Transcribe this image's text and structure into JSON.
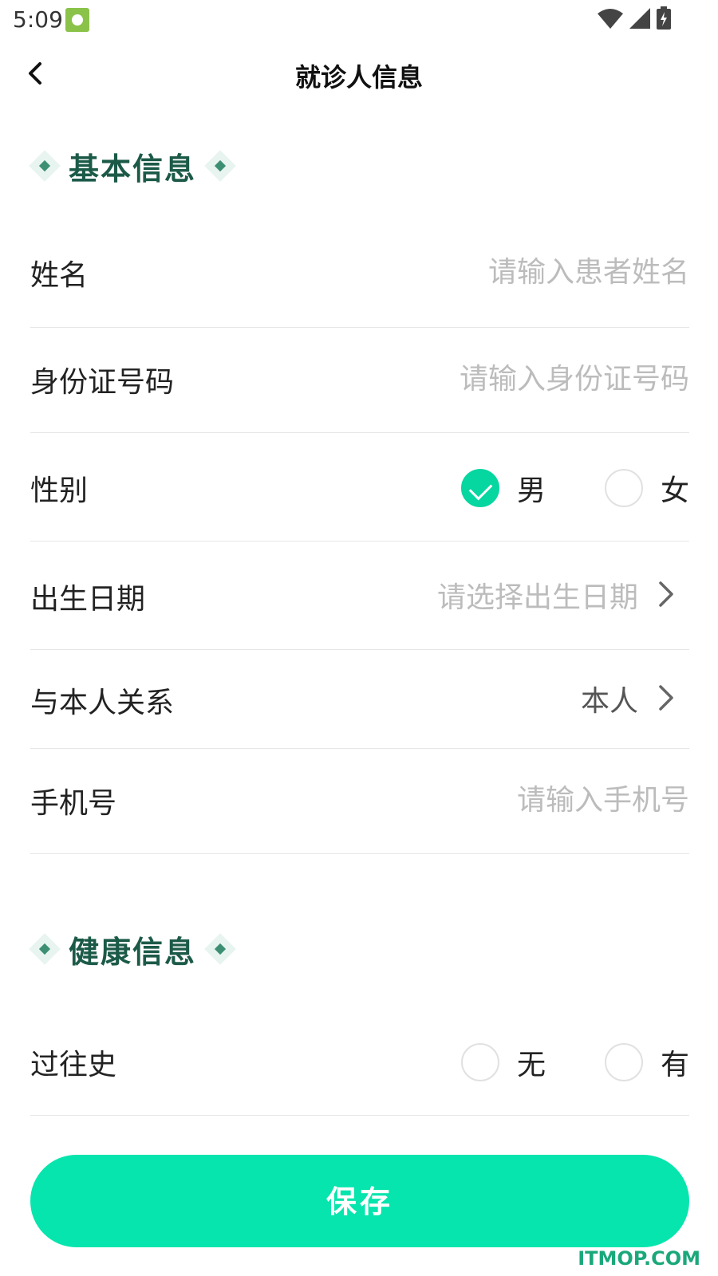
{
  "status_bar": {
    "time": "5:09",
    "app_icon": "android-notification-icon"
  },
  "navbar": {
    "title": "就诊人信息",
    "back_icon": "back-arrow-icon"
  },
  "basic_section": {
    "title": "基本信息",
    "fields": {
      "name": {
        "label": "姓名",
        "placeholder": "请输入患者姓名"
      },
      "id_number": {
        "label": "身份证号码",
        "placeholder": "请输入身份证号码"
      },
      "gender": {
        "label": "性别",
        "options": [
          "男",
          "女"
        ],
        "selected": "男"
      },
      "birth_date": {
        "label": "出生日期",
        "placeholder": "请选择出生日期"
      },
      "relationship": {
        "label": "与本人关系",
        "value": "本人"
      },
      "phone": {
        "label": "手机号",
        "placeholder": "请输入手机号"
      }
    }
  },
  "health_section": {
    "title": "健康信息",
    "fields": {
      "history": {
        "label": "过往史",
        "options": [
          "无",
          "有"
        ],
        "selected": ""
      }
    }
  },
  "save_button": {
    "label": "保存"
  },
  "watermark": "ITMOP.COM",
  "colors": {
    "accent": "#06e5ad",
    "checked": "#06d6a0",
    "section_title": "#1c5a48",
    "placeholder": "#bcbcbc"
  }
}
